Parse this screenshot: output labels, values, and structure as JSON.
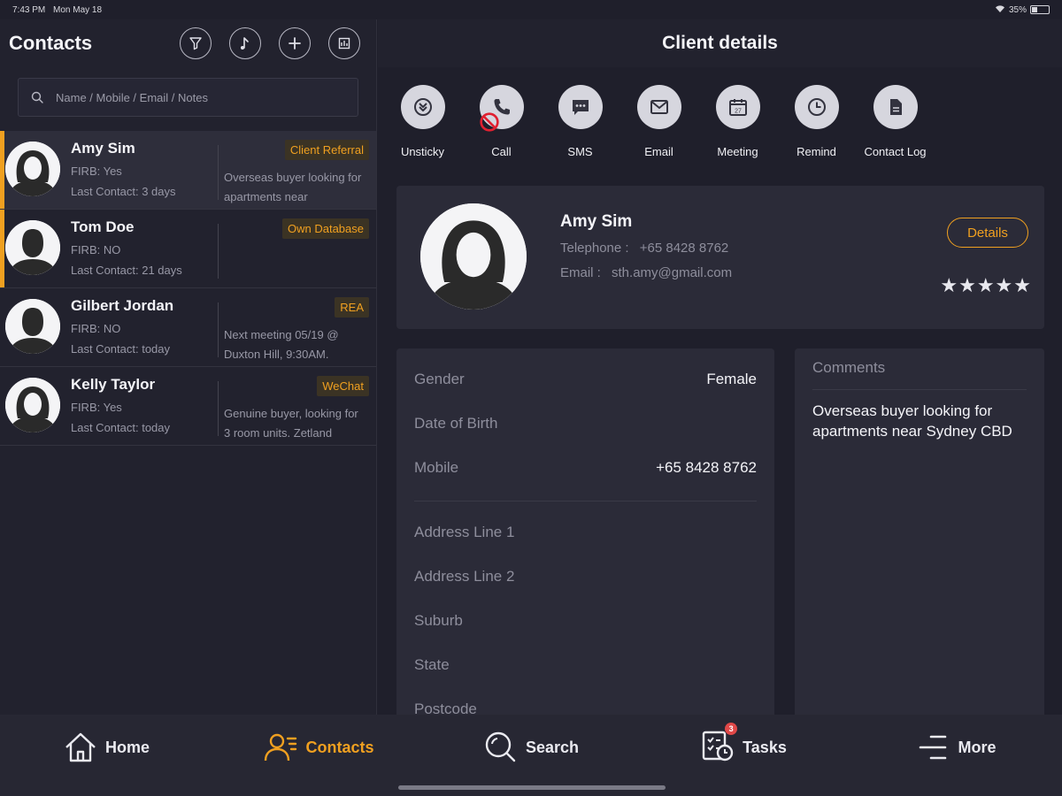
{
  "status_bar": {
    "time": "7:43 PM",
    "date": "Mon May 18",
    "battery": "35%"
  },
  "contacts_panel": {
    "title": "Contacts",
    "actions": [
      {
        "icon": "filter-icon"
      },
      {
        "icon": "sort-icon"
      },
      {
        "icon": "add-icon"
      },
      {
        "icon": "export-icon"
      }
    ],
    "search_placeholder": "Name / Mobile / Email / Notes",
    "contacts": [
      {
        "name": "Amy Sim",
        "firb": "FIRB: Yes",
        "last_contact": "Last Contact: 3 days",
        "tag": "Client Referral",
        "note": "Overseas buyer looking for apartments near",
        "avatar": "female",
        "flagged": true,
        "selected": true
      },
      {
        "name": "Tom Doe",
        "firb": "FIRB: NO",
        "last_contact": "Last Contact: 21 days",
        "tag": "Own Database",
        "note": "",
        "avatar": "male",
        "flagged": true,
        "selected": false
      },
      {
        "name": "Gilbert Jordan",
        "firb": "FIRB: NO",
        "last_contact": "Last Contact: today",
        "tag": "REA",
        "note": "Next meeting 05/19 @ Duxton Hill, 9:30AM.",
        "avatar": "male",
        "flagged": false,
        "selected": false
      },
      {
        "name": "Kelly Taylor",
        "firb": "FIRB: Yes",
        "last_contact": "Last Contact: today",
        "tag": "WeChat",
        "note": "Genuine buyer, looking for 3 room units. Zetland",
        "avatar": "female",
        "flagged": false,
        "selected": false
      }
    ]
  },
  "client_details": {
    "title": "Client details",
    "actions": [
      {
        "label": "Unsticky",
        "icon": "unsticky-icon"
      },
      {
        "label": "Call",
        "icon": "phone-icon"
      },
      {
        "label": "SMS",
        "icon": "sms-icon"
      },
      {
        "label": "Email",
        "icon": "email-icon"
      },
      {
        "label": "Meeting",
        "icon": "calendar-icon"
      },
      {
        "label": "Remind",
        "icon": "clock-icon"
      },
      {
        "label": "Contact Log",
        "icon": "document-icon"
      }
    ],
    "calendar_day": "27",
    "profile": {
      "name": "Amy Sim",
      "telephone_label": "Telephone :",
      "telephone": "+65 8428 8762",
      "email_label": "Email :",
      "email": "sth.amy@gmail.com",
      "details_button": "Details",
      "stars": "★★★★★",
      "rating": 5
    },
    "info": {
      "gender_label": "Gender",
      "gender": "Female",
      "dob_label": "Date of Birth",
      "dob": "",
      "mobile_label": "Mobile",
      "mobile": "+65 8428 8762",
      "address1_label": "Address Line 1",
      "address2_label": "Address Line 2",
      "suburb_label": "Suburb",
      "state_label": "State",
      "postcode_label": "Postcode"
    },
    "comments": {
      "title": "Comments",
      "text": "Overseas buyer looking for apartments near Sydney CBD"
    }
  },
  "tab_bar": {
    "tabs": [
      {
        "label": "Home",
        "icon": "home-icon",
        "active": false
      },
      {
        "label": "Contacts",
        "icon": "contacts-icon",
        "active": true
      },
      {
        "label": "Search",
        "icon": "search-icon",
        "active": false
      },
      {
        "label": "Tasks",
        "icon": "tasks-icon",
        "active": false,
        "badge": "3"
      },
      {
        "label": "More",
        "icon": "menu-icon",
        "active": false
      }
    ]
  },
  "colors": {
    "accent": "#f0a020",
    "background": "#1f1f2b",
    "card": "#2b2b38",
    "badge": "#e04848"
  }
}
